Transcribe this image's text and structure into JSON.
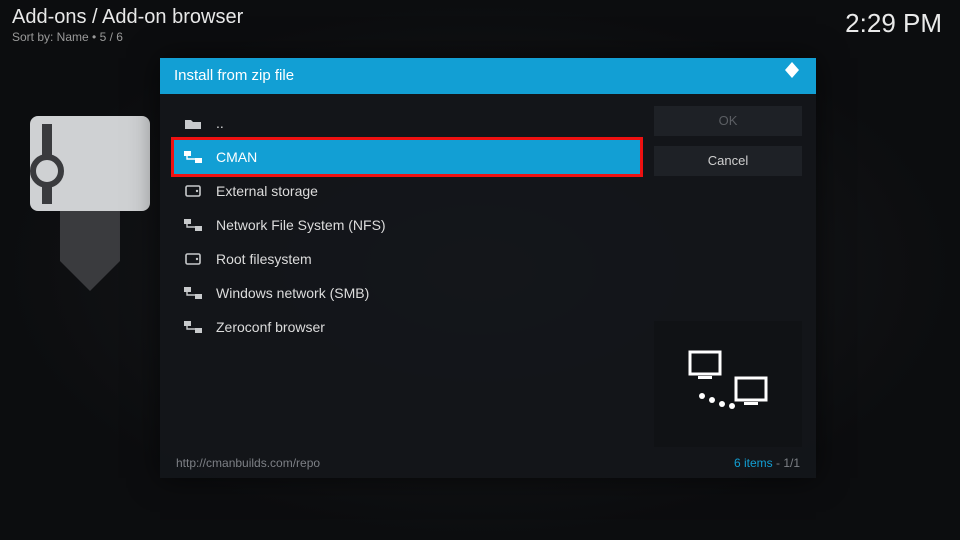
{
  "header": {
    "breadcrumb": "Add-ons / Add-on browser",
    "sortline": "Sort by: Name   •   5 / 6",
    "clock": "2:29 PM"
  },
  "dialog": {
    "title": "Install from zip file",
    "buttons": {
      "ok": "OK",
      "cancel": "Cancel"
    },
    "footer_path": "http://cmanbuilds.com/repo",
    "footer_count": "6 items",
    "footer_page": "1/1",
    "items": [
      {
        "icon": "folder-up",
        "label": "..",
        "selected": false,
        "highlight": false
      },
      {
        "icon": "net",
        "label": "CMAN",
        "selected": true,
        "highlight": true
      },
      {
        "icon": "drive",
        "label": "External storage",
        "selected": false,
        "highlight": false
      },
      {
        "icon": "net",
        "label": "Network File System (NFS)",
        "selected": false,
        "highlight": false
      },
      {
        "icon": "drive",
        "label": "Root filesystem",
        "selected": false,
        "highlight": false
      },
      {
        "icon": "net",
        "label": "Windows network (SMB)",
        "selected": false,
        "highlight": false
      },
      {
        "icon": "net",
        "label": "Zeroconf browser",
        "selected": false,
        "highlight": false
      }
    ]
  }
}
